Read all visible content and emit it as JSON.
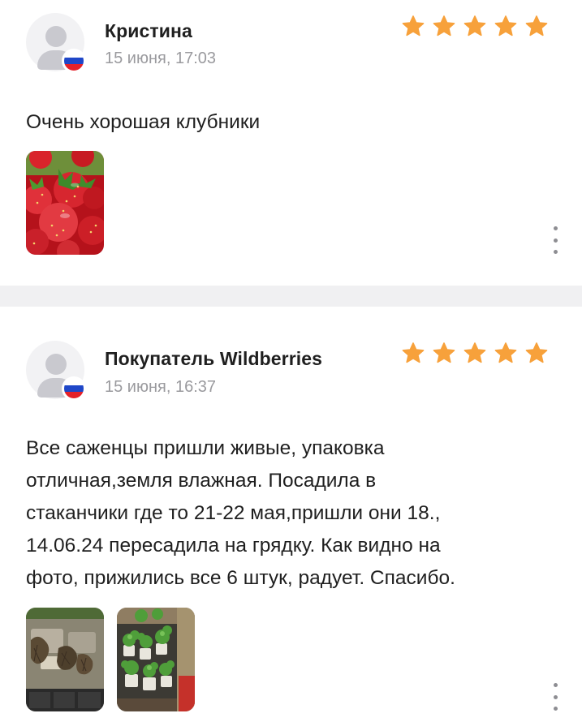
{
  "reviews": [
    {
      "author": "Кристина",
      "date": "15 июня, 17:03",
      "rating": 5,
      "text": "Очень хорошая клубники",
      "photos": [
        "strawberry-photo"
      ]
    },
    {
      "author": "Покупатель Wildberries",
      "date": "15 июня, 16:37",
      "rating": 5,
      "text_lines": [
        "Все саженцы пришли живые, упаковка",
        "отличная,земля влажная. Посадила в",
        "стаканчики где то 21-22 мая,пришли они 18.,",
        "14.06.24 пересадила на грядку. Как видно на",
        "фото, прижились все 6 штук, радует. Спасибо."
      ],
      "photos": [
        "seedlings-tray-photo",
        "seedlings-cups-photo"
      ]
    }
  ],
  "colors": {
    "star": "#f7a13b",
    "date": "#9a9a9e",
    "divider": "#f0f0f2",
    "flag_white": "#ffffff",
    "flag_blue": "#1f47c8",
    "flag_red": "#e52129"
  },
  "icons": [
    "user-avatar-icon",
    "russia-flag-icon",
    "star-icon",
    "more-vertical-icon"
  ]
}
